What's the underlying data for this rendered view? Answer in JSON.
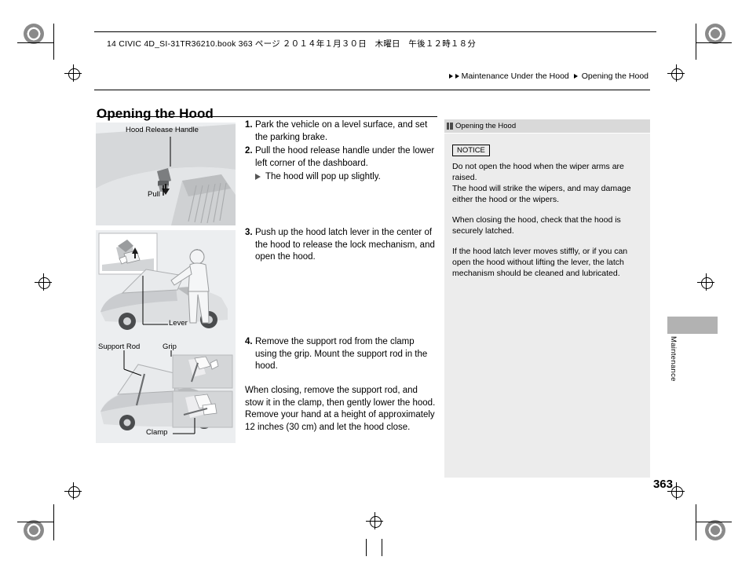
{
  "document": {
    "file_info": "14 CIVIC 4D_SI-31TR36210.book   363 ページ   ２０１４年１月３０日　木曜日　午後１２時１８分",
    "breadcrumb": {
      "section": "Maintenance Under the Hood",
      "subsection": "Opening the Hood"
    },
    "page_title": "Opening the Hood",
    "folio": "363",
    "side_tab_label": "Maintenance"
  },
  "steps": [
    {
      "num": "1.",
      "text": "Park the vehicle on a level surface, and set the parking brake."
    },
    {
      "num": "2.",
      "text": "Pull the hood release handle under the lower left corner of the dashboard.",
      "substep": "The hood will pop up slightly."
    }
  ],
  "step3": {
    "num": "3.",
    "text": "Push up the hood latch lever in the center of the hood to release the lock mechanism, and open the hood."
  },
  "step4": {
    "num": "4.",
    "text": "Remove the support rod from the clamp using the grip. Mount the support rod in the hood."
  },
  "closing_paragraph": "When closing, remove the support rod, and stow it in the clamp, then gently lower the hood. Remove your hand at a height of approximately 12 inches (30 cm) and let the hood close.",
  "figures": {
    "fig1": {
      "callout_top": "Hood Release Handle",
      "callout_bottom": "Pull"
    },
    "fig2": {
      "callout_bottom": "Lever"
    },
    "fig3": {
      "callout_left": "Support Rod",
      "callout_right": "Grip",
      "callout_bottom": "Clamp"
    }
  },
  "sidebar": {
    "title": "Opening the Hood",
    "notice_badge": "NOTICE",
    "paragraphs": [
      "Do not open the hood when the wiper arms are raised.",
      "The hood will strike the wipers, and may damage either the hood or the wipers.",
      "When closing the hood, check that the hood is securely latched.",
      "If the hood latch lever moves stiffly, or if you can open the hood without lifting the lever, the latch mechanism should be cleaned and lubricated."
    ]
  },
  "colors": {
    "figure_bg": "#eceef0",
    "sidebar_bg": "#ececec",
    "sidebar_header_bg": "#d9d9d9",
    "tab_gray": "#b2b2b2"
  }
}
